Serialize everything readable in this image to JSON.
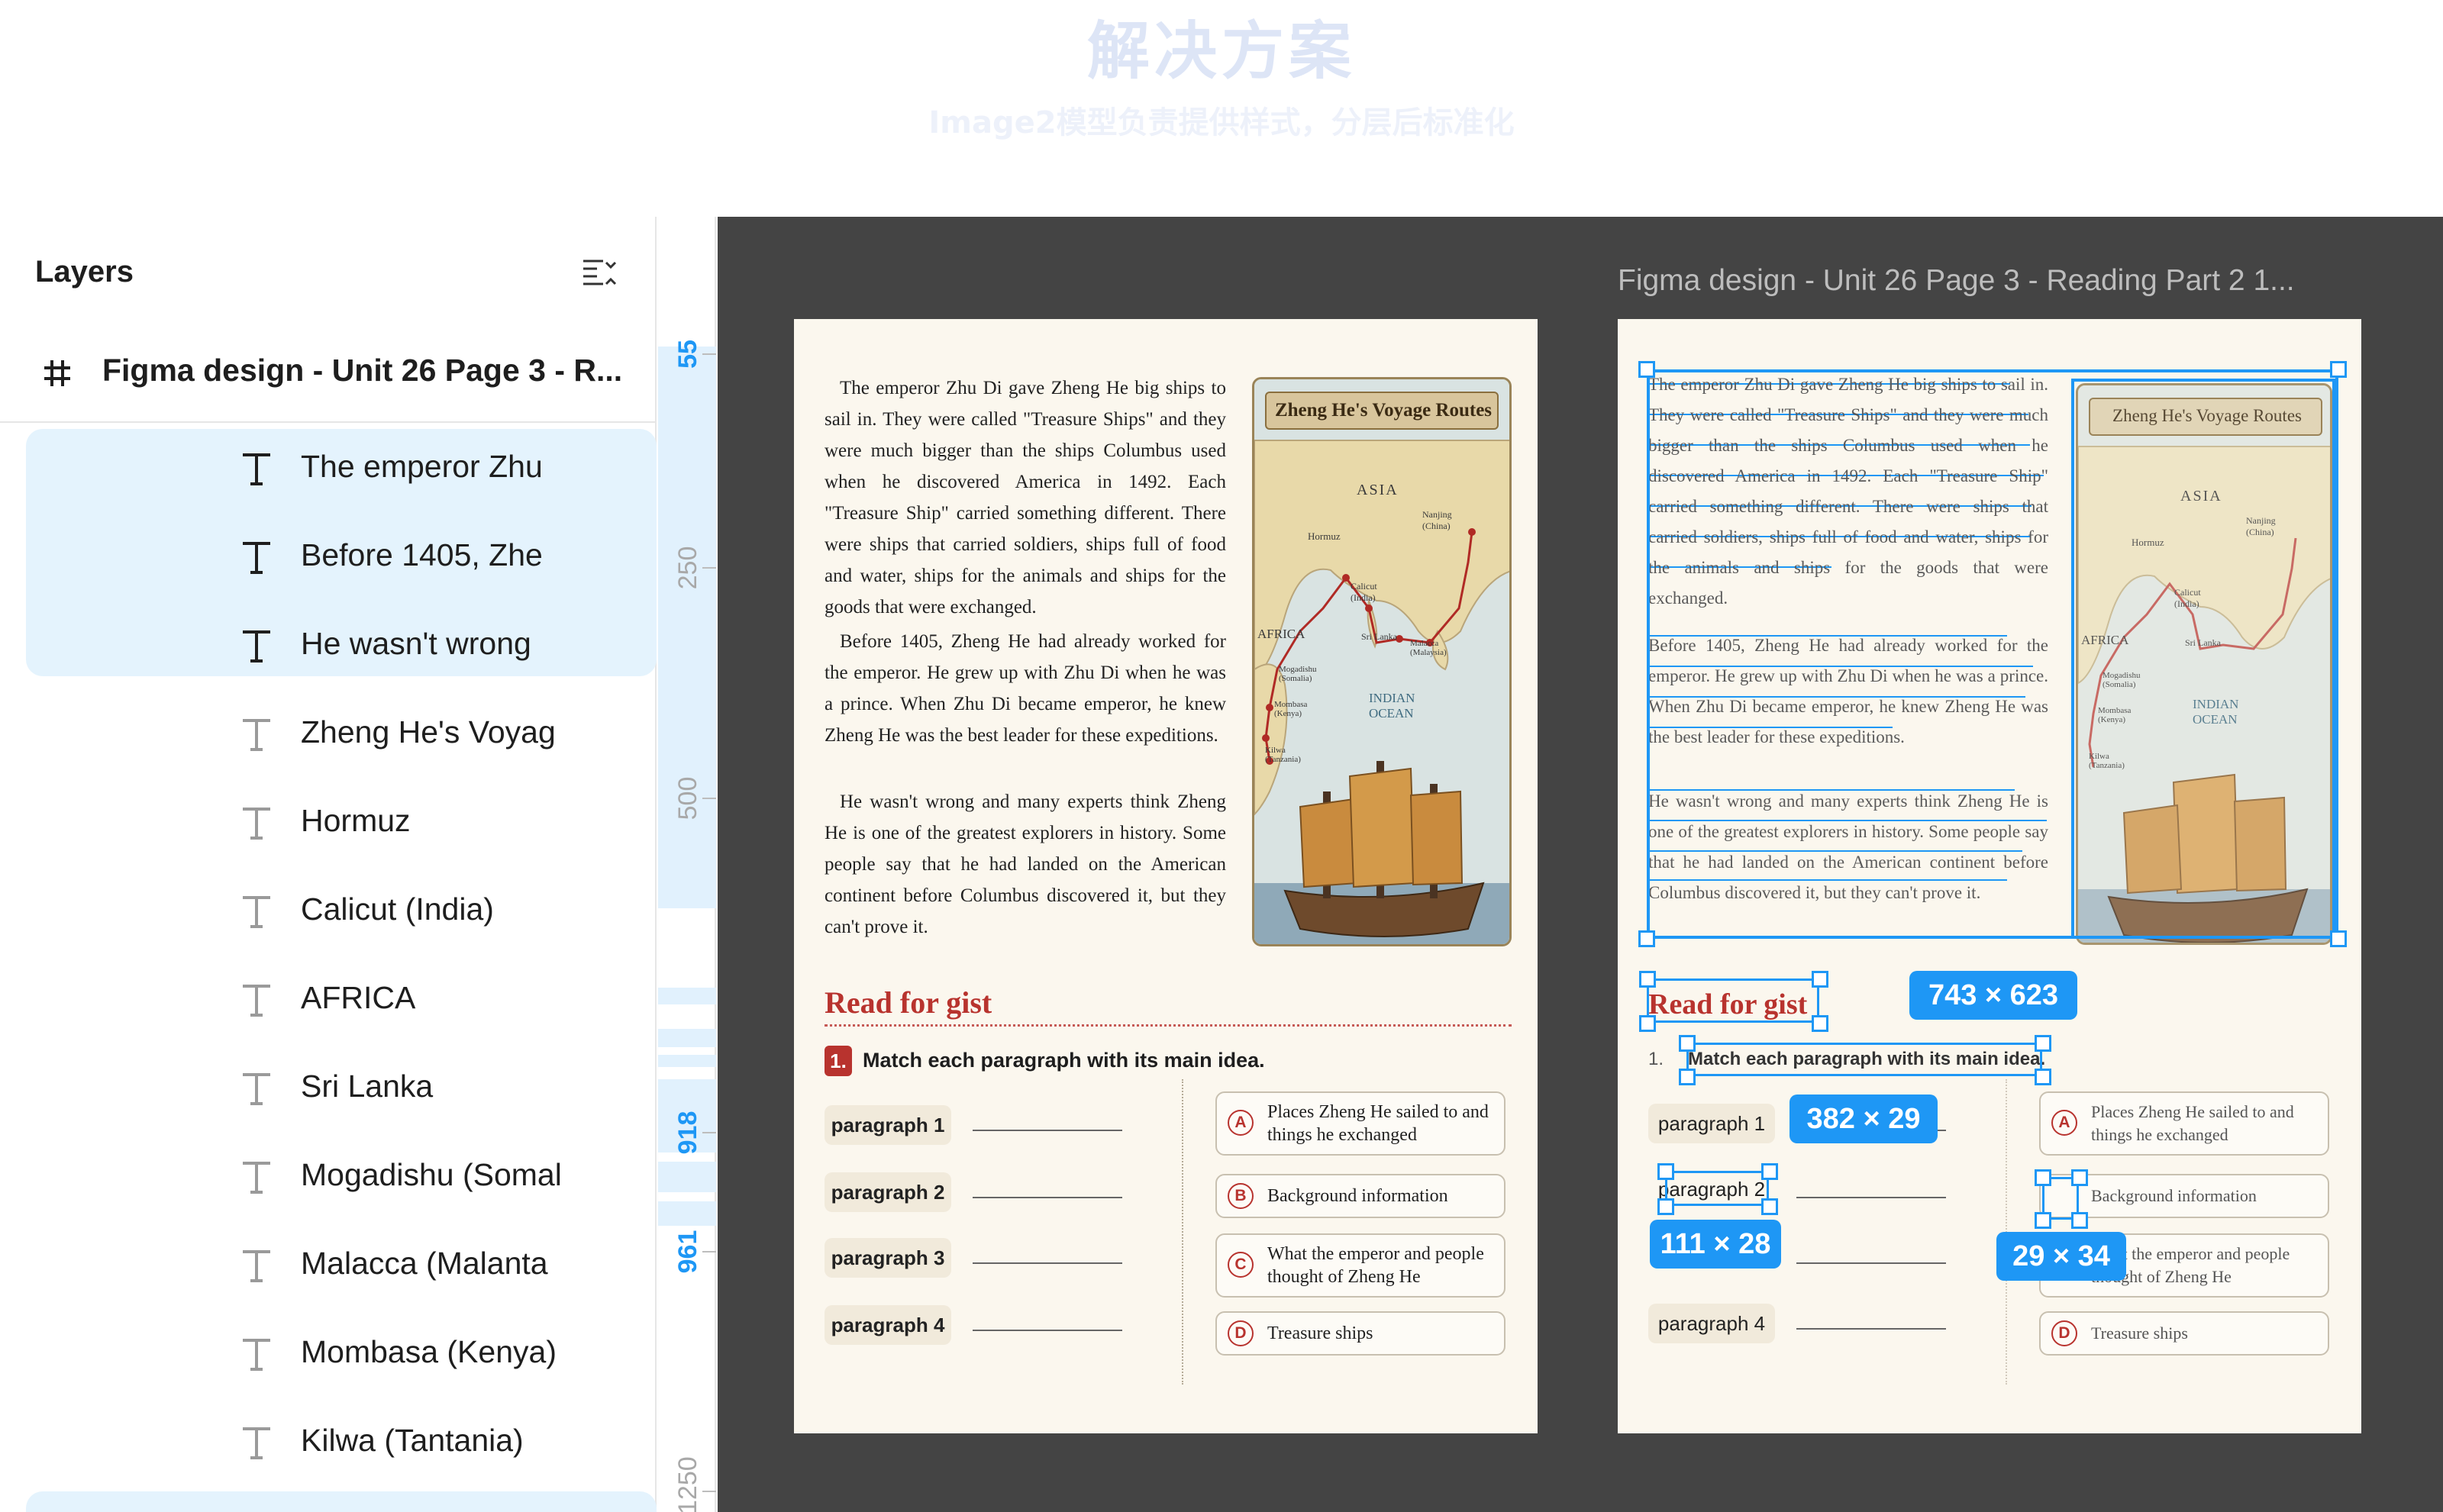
{
  "banner": {
    "title": "解决方案",
    "subtitle": "Image2模型负责提供样式，分层后标准化"
  },
  "layers_panel": {
    "header": "Layers",
    "frame_name": "Figma design - Unit 26 Page 3 - R...",
    "items": [
      {
        "label": "The emperor Zhu",
        "selected": true
      },
      {
        "label": "Before 1405, Zhe",
        "selected": true
      },
      {
        "label": "He wasn't wrong",
        "selected": true
      },
      {
        "label": "Zheng He's Voyag",
        "selected": false
      },
      {
        "label": "Hormuz",
        "selected": false
      },
      {
        "label": "Calicut (India)",
        "selected": false
      },
      {
        "label": "AFRICA",
        "selected": false
      },
      {
        "label": "Sri Lanka",
        "selected": false
      },
      {
        "label": "Mogadishu (Somal",
        "selected": false
      },
      {
        "label": "Malacca (Malanta",
        "selected": false
      },
      {
        "label": "Mombasa (Kenya)",
        "selected": false
      },
      {
        "label": "Kilwa (Tantania)",
        "selected": false
      }
    ]
  },
  "ruler": {
    "marks": [
      {
        "value": "55",
        "active": true
      },
      {
        "value": "250",
        "active": false
      },
      {
        "value": "500",
        "active": false
      },
      {
        "value": "918",
        "active": true
      },
      {
        "value": "961",
        "active": true
      },
      {
        "value": "1250",
        "active": false
      }
    ]
  },
  "canvas": {
    "frame_label": "Figma design - Unit 26 Page 3 - Reading Part 2 1...",
    "paragraphs": [
      "The emperor Zhu Di gave Zheng He big ships to sail in. They were called \"Treasure Ships\" and they were much bigger than the ships Columbus used when he discovered America in 1492. Each \"Treasure Ship\" carried something different. There were ships that carried soldiers, ships full of food and water, ships for the animals and ships for the goods that were exchanged.",
      "Before 1405, Zheng He had already worked for the emperor. He grew up with Zhu Di when he was a prince. When Zhu Di became emperor, he knew Zheng He was the best leader for these expeditions.",
      "He wasn't wrong and many experts think Zheng He is one of the greatest explorers in history. Some people say that he had landed on the American continent before Columbus discovered it, but they can't prove it."
    ],
    "map": {
      "title": "Zheng He's Voyage Routes",
      "labels": {
        "asia": "ASIA",
        "africa": "AFRICA",
        "indian_ocean": "INDIAN\nOCEAN",
        "hormuz": "Hormuz",
        "calicut": "Calicut\n(India)",
        "sri_lanka": "Sri Lanka",
        "nanjing": "Nanjing\n(China)",
        "malacca": "Malacca\n(Malaysia)",
        "mogadishu": "Mogadishu\n(Somalia)",
        "mombasa": "Mombasa\n(Kenya)",
        "kilwa": "Kilwa\n(Tanzania)"
      }
    },
    "gist_title": "Read for gist",
    "task_number": "1.",
    "task_text": "Match each paragraph with its main idea.",
    "paragraph_chips": [
      "paragraph 1",
      "paragraph 2",
      "paragraph 3",
      "paragraph 4"
    ],
    "main_ideas": [
      {
        "letter": "A",
        "text": "Places Zheng He sailed to and things he exchanged"
      },
      {
        "letter": "B",
        "text": "Background information"
      },
      {
        "letter": "C",
        "text": "What the emperor and people thought of Zheng He"
      },
      {
        "letter": "D",
        "text": "Treasure ships"
      }
    ],
    "dimension_badges": [
      "743 × 623",
      "382 × 29",
      "111 × 28",
      "29 × 34"
    ],
    "colors": {
      "accent": "#1e97f5",
      "canvas": "#444444",
      "page": "#fbf7ee",
      "heading_red": "#b8332e",
      "selection_bg": "#e4f3fd"
    }
  }
}
